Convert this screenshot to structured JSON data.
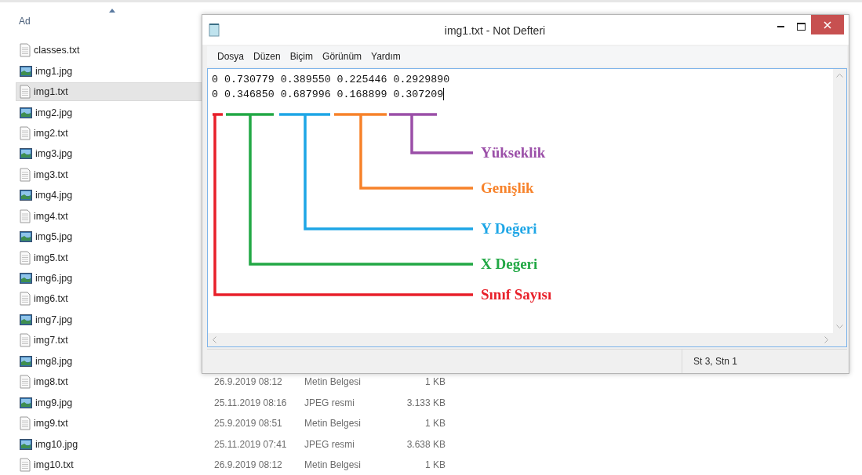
{
  "explorer": {
    "column_header": "Ad",
    "files": [
      {
        "name": "classes.txt",
        "kind": "text",
        "selected": false
      },
      {
        "name": "img1.jpg",
        "kind": "image",
        "selected": false
      },
      {
        "name": "img1.txt",
        "kind": "text",
        "selected": true
      },
      {
        "name": "img2.jpg",
        "kind": "image",
        "selected": false
      },
      {
        "name": "img2.txt",
        "kind": "text",
        "selected": false
      },
      {
        "name": "img3.jpg",
        "kind": "image",
        "selected": false
      },
      {
        "name": "img3.txt",
        "kind": "text",
        "selected": false
      },
      {
        "name": "img4.jpg",
        "kind": "image",
        "selected": false
      },
      {
        "name": "img4.txt",
        "kind": "text",
        "selected": false
      },
      {
        "name": "img5.jpg",
        "kind": "image",
        "selected": false
      },
      {
        "name": "img5.txt",
        "kind": "text",
        "selected": false
      },
      {
        "name": "img6.jpg",
        "kind": "image",
        "selected": false
      },
      {
        "name": "img6.txt",
        "kind": "text",
        "selected": false
      },
      {
        "name": "img7.jpg",
        "kind": "image",
        "selected": false
      },
      {
        "name": "img7.txt",
        "kind": "text",
        "selected": false
      },
      {
        "name": "img8.jpg",
        "kind": "image",
        "selected": false
      },
      {
        "name": "img8.txt",
        "kind": "text",
        "selected": false,
        "date": "26.9.2019 08:12",
        "type": "Metin Belgesi",
        "size": "1 KB"
      },
      {
        "name": "img9.jpg",
        "kind": "image",
        "selected": false,
        "date": "25.11.2019 08:16",
        "type": "JPEG resmi",
        "size": "3.133 KB"
      },
      {
        "name": "img9.txt",
        "kind": "text",
        "selected": false,
        "date": "25.9.2019 08:51",
        "type": "Metin Belgesi",
        "size": "1 KB"
      },
      {
        "name": "img10.jpg",
        "kind": "image",
        "selected": false,
        "date": "25.11.2019 07:41",
        "type": "JPEG resmi",
        "size": "3.638 KB"
      },
      {
        "name": "img10.txt",
        "kind": "text",
        "selected": false,
        "date": "26.9.2019 08:12",
        "type": "Metin Belgesi",
        "size": "1 KB"
      }
    ]
  },
  "notepad": {
    "title": "img1.txt - Not Defteri",
    "menu": [
      "Dosya",
      "Düzen",
      "Biçim",
      "Görünüm",
      "Yardım"
    ],
    "lines": [
      "0 0.730779 0.389550 0.225446 0.2929890",
      "0 0.346850 0.687996 0.168899 0.307209"
    ],
    "annotations": [
      {
        "label": "Yükseklik",
        "color": "#9b4fa8"
      },
      {
        "label": "Genişlik",
        "color": "#f7822a"
      },
      {
        "label": "Y Değeri",
        "color": "#1ea6e6"
      },
      {
        "label": "X Değeri",
        "color": "#22a845"
      },
      {
        "label": "Sınıf Sayısı",
        "color": "#e8202a"
      }
    ],
    "status": "St 3, Stn 1"
  }
}
